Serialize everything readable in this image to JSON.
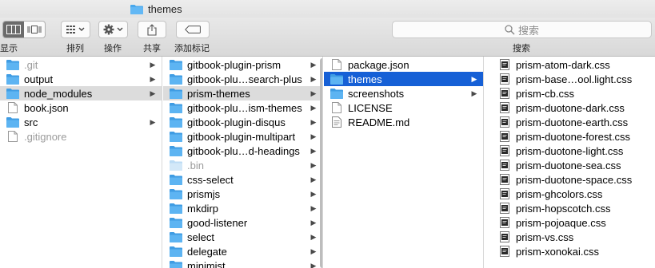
{
  "window": {
    "title": "themes"
  },
  "toolbar": {
    "view_label": "显示",
    "arrange_label": "排列",
    "action_label": "操作",
    "share_label": "共享",
    "tags_label": "添加标记",
    "search_placeholder": "搜索",
    "search_label": "搜索"
  },
  "columns": [
    {
      "items": [
        {
          "name": ".git",
          "kind": "folder",
          "arrow": "▶",
          "state": "dim"
        },
        {
          "name": "output",
          "kind": "folder",
          "arrow": "▶",
          "state": ""
        },
        {
          "name": "node_modules",
          "kind": "folder",
          "arrow": "▶",
          "state": "sel-gray"
        },
        {
          "name": "book.json",
          "kind": "file",
          "arrow": "",
          "state": ""
        },
        {
          "name": "src",
          "kind": "folder",
          "arrow": "▶",
          "state": ""
        },
        {
          "name": ".gitignore",
          "kind": "file",
          "arrow": "",
          "state": "dim"
        }
      ]
    },
    {
      "items": [
        {
          "name": "gitbook-plugin-prism",
          "kind": "folder",
          "arrow": "▶",
          "state": ""
        },
        {
          "name": "gitbook-plu…search-plus",
          "kind": "folder",
          "arrow": "▶",
          "state": ""
        },
        {
          "name": "prism-themes",
          "kind": "folder",
          "arrow": "▶",
          "state": "sel-gray"
        },
        {
          "name": "gitbook-plu…ism-themes",
          "kind": "folder",
          "arrow": "▶",
          "state": ""
        },
        {
          "name": "gitbook-plugin-disqus",
          "kind": "folder",
          "arrow": "▶",
          "state": ""
        },
        {
          "name": "gitbook-plugin-multipart",
          "kind": "folder",
          "arrow": "▶",
          "state": ""
        },
        {
          "name": "gitbook-plu…d-headings",
          "kind": "folder",
          "arrow": "▶",
          "state": ""
        },
        {
          "name": ".bin",
          "kind": "folder-light",
          "arrow": "▶",
          "state": "dim"
        },
        {
          "name": "css-select",
          "kind": "folder",
          "arrow": "▶",
          "state": ""
        },
        {
          "name": "prismjs",
          "kind": "folder",
          "arrow": "▶",
          "state": ""
        },
        {
          "name": "mkdirp",
          "kind": "folder",
          "arrow": "▶",
          "state": ""
        },
        {
          "name": "good-listener",
          "kind": "folder",
          "arrow": "▶",
          "state": ""
        },
        {
          "name": "select",
          "kind": "folder",
          "arrow": "▶",
          "state": ""
        },
        {
          "name": "delegate",
          "kind": "folder",
          "arrow": "▶",
          "state": ""
        },
        {
          "name": "minimist",
          "kind": "folder",
          "arrow": "▶",
          "state": ""
        }
      ]
    },
    {
      "items": [
        {
          "name": "package.json",
          "kind": "file",
          "arrow": "",
          "state": ""
        },
        {
          "name": "themes",
          "kind": "folder",
          "arrow": "▶",
          "state": "sel-blue"
        },
        {
          "name": "screenshots",
          "kind": "folder",
          "arrow": "▶",
          "state": ""
        },
        {
          "name": "LICENSE",
          "kind": "file",
          "arrow": "",
          "state": ""
        },
        {
          "name": "README.md",
          "kind": "doc",
          "arrow": "",
          "state": ""
        }
      ]
    },
    {
      "items": [
        {
          "name": "prism-atom-dark.css",
          "kind": "css",
          "arrow": "",
          "state": ""
        },
        {
          "name": "prism-base…ool.light.css",
          "kind": "css",
          "arrow": "",
          "state": ""
        },
        {
          "name": "prism-cb.css",
          "kind": "css",
          "arrow": "",
          "state": ""
        },
        {
          "name": "prism-duotone-dark.css",
          "kind": "css",
          "arrow": "",
          "state": ""
        },
        {
          "name": "prism-duotone-earth.css",
          "kind": "css",
          "arrow": "",
          "state": ""
        },
        {
          "name": "prism-duotone-forest.css",
          "kind": "css",
          "arrow": "",
          "state": ""
        },
        {
          "name": "prism-duotone-light.css",
          "kind": "css",
          "arrow": "",
          "state": ""
        },
        {
          "name": "prism-duotone-sea.css",
          "kind": "css",
          "arrow": "",
          "state": ""
        },
        {
          "name": "prism-duotone-space.css",
          "kind": "css",
          "arrow": "",
          "state": ""
        },
        {
          "name": "prism-ghcolors.css",
          "kind": "css",
          "arrow": "",
          "state": ""
        },
        {
          "name": "prism-hopscotch.css",
          "kind": "css",
          "arrow": "",
          "state": ""
        },
        {
          "name": "prism-pojoaque.css",
          "kind": "css",
          "arrow": "",
          "state": ""
        },
        {
          "name": "prism-vs.css",
          "kind": "css",
          "arrow": "",
          "state": ""
        },
        {
          "name": "prism-xonokai.css",
          "kind": "css",
          "arrow": "",
          "state": ""
        }
      ]
    }
  ],
  "colors": {
    "folder": "#4aa8ec",
    "selection_blue": "#1660d6",
    "selection_gray": "#dcdcdc"
  }
}
